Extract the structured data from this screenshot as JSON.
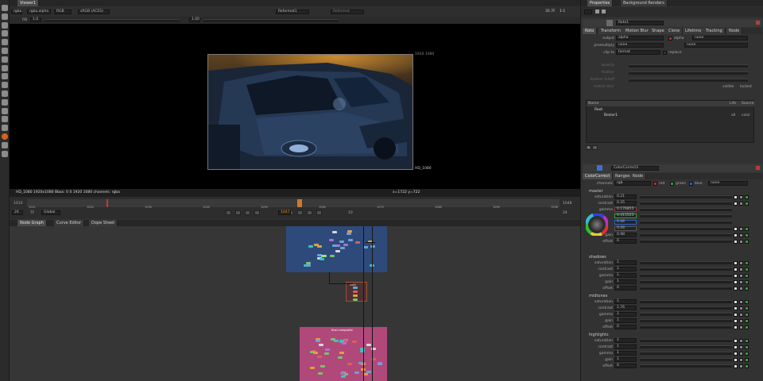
{
  "toolbar": {
    "icons": [
      "pointer-icon",
      "paint-icon",
      "merge-icon",
      "transform-icon",
      "color-icon",
      "filter-icon",
      "keyer-icon",
      "channel-icon",
      "time-icon",
      "3d-icon",
      "particle-icon",
      "deep-icon",
      "views-icon",
      "metadata-icon",
      "toolsets-icon",
      "other-icon",
      "furnace-icon",
      "nuke-logo-icon"
    ]
  },
  "viewer": {
    "tab": "Viewer1",
    "layer": "rgba",
    "channel_set": "rgba.alpha",
    "display": "RGB",
    "colorspace": "sRGB (ACES)",
    "input_a": "Reformat1",
    "input_b": "Reformat",
    "zoom": "35.7F",
    "proxy": "1:1",
    "gain_label": "f/8",
    "gain_value": "1.0",
    "gamma_value": "1.00",
    "format_top": "1920 1080",
    "format_bottom": "HD_1080",
    "status_info": "HD_1080 1920x1080  Bbox: 0 0 1920 1080 channels: rgba",
    "cursor_info": "x=1722 y=722"
  },
  "timeline": {
    "start": "1010",
    "end": "1048",
    "ticks": [
      "1011",
      "1020",
      "1030",
      "1040",
      "1050",
      "1060",
      "1070",
      "1080",
      "1090",
      "1098"
    ],
    "current_frame": "1047",
    "fps": "24",
    "tf": "TF",
    "scope": "Global",
    "step": "10",
    "inc": "24"
  },
  "graph_tabs": [
    "Node Graph",
    "Curve Editor",
    "Dope Sheet"
  ],
  "graph": {
    "backdrop_mid_label": "note",
    "backdrop_pink_label": "final composite"
  },
  "properties": {
    "tabs": [
      "Properties",
      "Background Renders"
    ],
    "roto": {
      "name": "Roto1",
      "tabs": [
        "Roto",
        "Transform",
        "Motion Blur",
        "Shape",
        "Clone",
        "Lifetime",
        "Tracking",
        "Node"
      ],
      "output_label": "output",
      "output_value": "alpha",
      "output_check": "alpha",
      "output_extra": "none",
      "premult_label": "premultiply",
      "premult_value": "none",
      "premult_extra": "none",
      "clip_label": "clip to",
      "clip_value": "format",
      "replace": "replace",
      "opacity": "opacity",
      "feather": "feather",
      "feather_falloff": "feather falloff",
      "motion_blur": "motion blur",
      "visible": "visible",
      "locked": "locked",
      "list_headers": [
        "Name",
        "Life",
        "Source"
      ],
      "items": [
        {
          "name": "Root",
          "life": "",
          "source": ""
        },
        {
          "name": "Bezier1",
          "life": "all",
          "source": "color"
        }
      ]
    },
    "cc": {
      "name": "ColorCorrect3",
      "tabs": [
        "ColorCorrect",
        "Ranges",
        "Node"
      ],
      "channels_label": "channels",
      "channels_value": "rgb",
      "ch_red": "red",
      "ch_green": "green",
      "ch_blue": "blue",
      "ch_none": "none",
      "master": {
        "title": "master",
        "saturation": "0.21",
        "contrast": "0.35",
        "gamma": "",
        "gamma_values": [
          "0.176855",
          "0.415523",
          "0.44",
          "0.44"
        ],
        "gain": "0.98",
        "offset": "0"
      },
      "shadows": {
        "title": "shadows",
        "saturation": "1",
        "contrast": "1",
        "gamma": "1",
        "gain": "1",
        "offset": "0"
      },
      "midtones": {
        "title": "midtones",
        "saturation": "1",
        "contrast": "1.76",
        "gamma": "1",
        "gain": "1",
        "offset": "0"
      },
      "highlights": {
        "title": "highlights",
        "saturation": "1",
        "contrast": "1",
        "gamma": "1",
        "gain": "1",
        "offset": "0"
      }
    }
  }
}
